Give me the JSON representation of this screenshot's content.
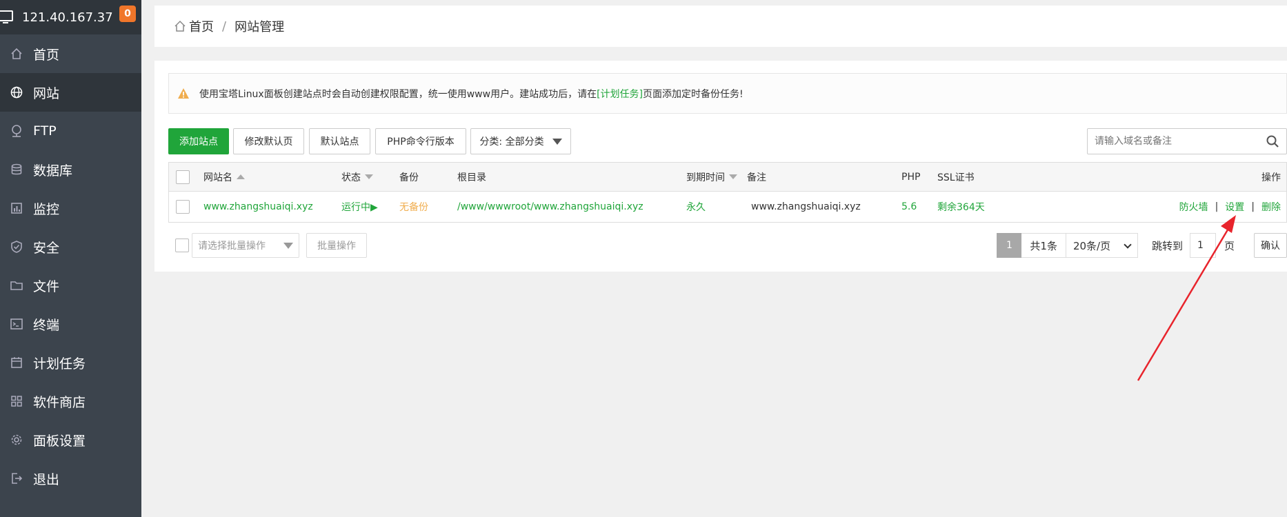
{
  "sidebar": {
    "ip": "121.40.167.37",
    "badge": "0",
    "items": [
      {
        "label": "首页",
        "icon": "home-icon"
      },
      {
        "label": "网站",
        "icon": "globe-icon",
        "active": true
      },
      {
        "label": "FTP",
        "icon": "ftp-icon"
      },
      {
        "label": "数据库",
        "icon": "database-icon"
      },
      {
        "label": "监控",
        "icon": "monitor-chart-icon"
      },
      {
        "label": "安全",
        "icon": "shield-icon"
      },
      {
        "label": "文件",
        "icon": "folder-icon"
      },
      {
        "label": "终端",
        "icon": "terminal-icon"
      },
      {
        "label": "计划任务",
        "icon": "calendar-icon"
      },
      {
        "label": "软件商店",
        "icon": "grid-icon"
      },
      {
        "label": "面板设置",
        "icon": "gear-icon"
      },
      {
        "label": "退出",
        "icon": "logout-icon"
      }
    ]
  },
  "breadcrumb": {
    "home": "首页",
    "separator": "/",
    "current": "网站管理"
  },
  "notice": {
    "text_before": "使用宝塔Linux面板创建站点时会自动创建权限配置，统一使用www用户。建站成功后，请在",
    "link": "[计划任务]",
    "text_after": "页面添加定时备份任务!"
  },
  "toolbar": {
    "add_site": "添加站点",
    "edit_default_page": "修改默认页",
    "default_site": "默认站点",
    "php_cli_version": "PHP命令行版本",
    "category": "分类: 全部分类",
    "search_placeholder": "请输入域名或备注"
  },
  "table": {
    "headers": {
      "name": "网站名",
      "status": "状态",
      "backup": "备份",
      "root": "根目录",
      "expire": "到期时间",
      "remark": "备注",
      "php": "PHP",
      "ssl": "SSL证书",
      "ops": "操作"
    },
    "rows": [
      {
        "name": "www.zhangshuaiqi.xyz",
        "status": "运行中▶",
        "backup": "无备份",
        "root": "/www/wwwroot/www.zhangshuaiqi.xyz",
        "expire": "永久",
        "remark": "www.zhangshuaiqi.xyz",
        "php": "5.6",
        "ssl": "剩余364天",
        "op_firewall": "防火墙",
        "op_sep": "|",
        "op_settings": "设置",
        "op_delete": "删除"
      }
    ]
  },
  "footer": {
    "bulk_placeholder": "请选择批量操作",
    "bulk_button": "批量操作",
    "current_page": "1",
    "total": "共1条",
    "page_size": "20条/页",
    "jump_label": "跳转到",
    "jump_value": "1",
    "page_unit": "页",
    "confirm": "确认"
  },
  "colors": {
    "sidebar_bg": "#3c444d",
    "sidebar_active": "#2f353b",
    "accent_green": "#20a53a",
    "warning_orange": "#f0ad4e",
    "badge_orange": "#f0762a",
    "annotation_red": "#e8242c"
  }
}
